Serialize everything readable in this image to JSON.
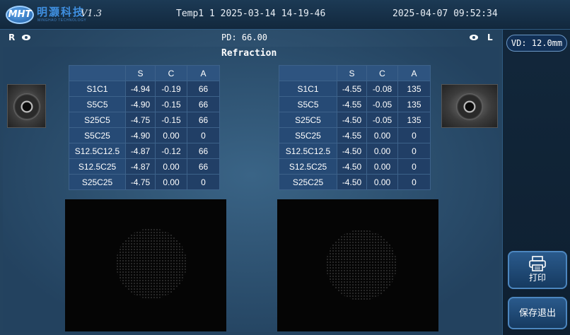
{
  "header": {
    "logo_text": "MHT",
    "brand_cn": "明灏科技",
    "brand_en": "MINGHAO TECHNOLOGY",
    "version": "V1.3",
    "session": "Temp1 1 2025-03-14 14-19-46",
    "datetime": "2025-04-07 09:52:34"
  },
  "measure": {
    "right_eye_label": "R",
    "left_eye_label": "L",
    "pd_text": "PD: 66.00",
    "title": "Refraction"
  },
  "table_headers": [
    "",
    "S",
    "C",
    "A"
  ],
  "right_rows": [
    [
      "S1C1",
      "-4.94",
      "-0.19",
      "66"
    ],
    [
      "S5C5",
      "-4.90",
      "-0.15",
      "66"
    ],
    [
      "S25C5",
      "-4.75",
      "-0.15",
      "66"
    ],
    [
      "S5C25",
      "-4.90",
      "0.00",
      "0"
    ],
    [
      "S12.5C12.5",
      "-4.87",
      "-0.12",
      "66"
    ],
    [
      "S12.5C25",
      "-4.87",
      "0.00",
      "66"
    ],
    [
      "S25C25",
      "-4.75",
      "0.00",
      "0"
    ]
  ],
  "left_rows": [
    [
      "S1C1",
      "-4.55",
      "-0.08",
      "135"
    ],
    [
      "S5C5",
      "-4.55",
      "-0.05",
      "135"
    ],
    [
      "S25C5",
      "-4.50",
      "-0.05",
      "135"
    ],
    [
      "S5C25",
      "-4.55",
      "0.00",
      "0"
    ],
    [
      "S12.5C12.5",
      "-4.50",
      "0.00",
      "0"
    ],
    [
      "S12.5C25",
      "-4.50",
      "0.00",
      "0"
    ],
    [
      "S25C25",
      "-4.50",
      "0.00",
      "0"
    ]
  ],
  "sidebar": {
    "vd": "VD: 12.0mm",
    "print_label": "打印",
    "save_exit_label": "保存退出"
  },
  "icons": {
    "eye": "eye-icon",
    "print": "printer-icon"
  }
}
